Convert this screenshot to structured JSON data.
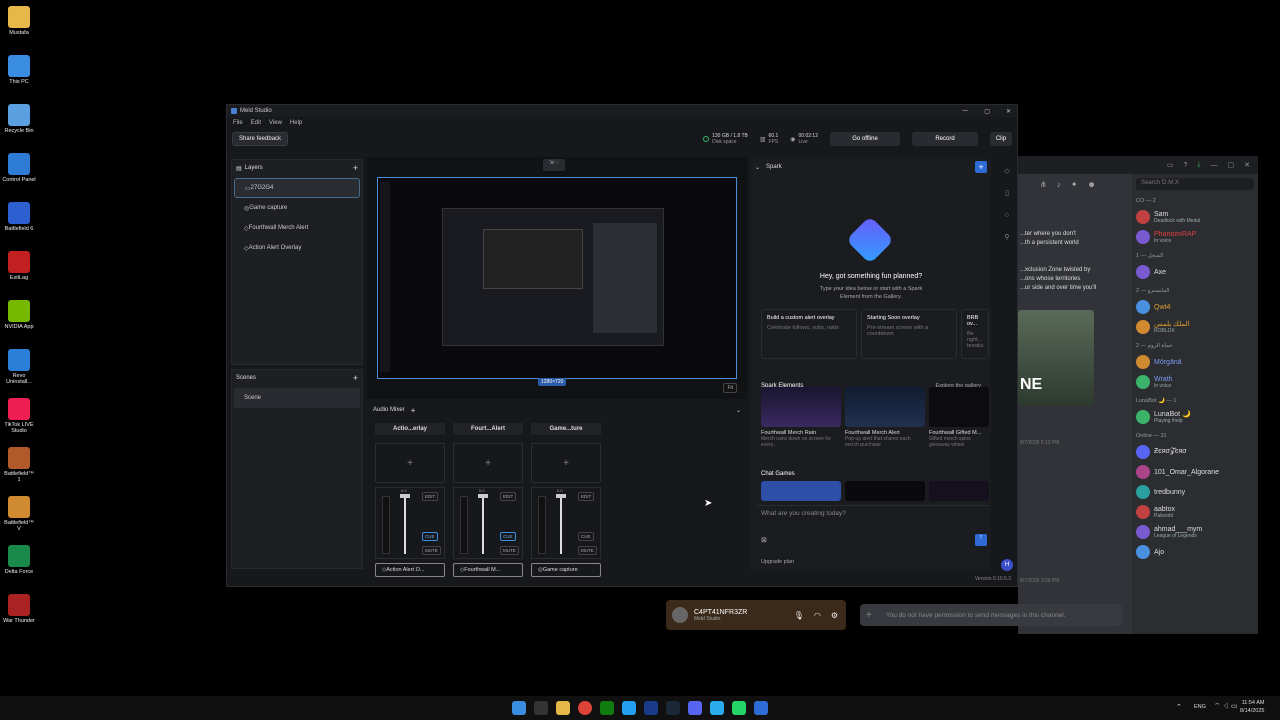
{
  "desktop_icons": [
    {
      "label": "Mustafa",
      "icon": "folder-icon",
      "color": "#e6b84a"
    },
    {
      "label": "This PC",
      "icon": "computer-icon",
      "color": "#3a8de0"
    },
    {
      "label": "Recycle Bin",
      "icon": "recycle-bin-icon",
      "color": "#5aa0e0"
    },
    {
      "label": "Control Panel",
      "icon": "control-panel-icon",
      "color": "#2e7bd6"
    },
    {
      "label": "Battlefield 6",
      "icon": "bf-icon",
      "color": "#2d5fd0"
    },
    {
      "label": "ExitLag",
      "icon": "exitlag-icon",
      "color": "#c02020"
    },
    {
      "label": "NVIDIA App",
      "icon": "nvidia-icon",
      "color": "#76b900"
    },
    {
      "label": "Revo Uninstall...",
      "icon": "revo-icon",
      "color": "#2b7fd8"
    },
    {
      "label": "TikTok LIVE Studio",
      "icon": "tiktok-icon",
      "color": "#ee1d52"
    },
    {
      "label": "Battlefield™ 1",
      "icon": "bf1-icon",
      "color": "#b05a2a"
    },
    {
      "label": "Battlefield™ V",
      "icon": "bfv-icon",
      "color": "#d08a30"
    },
    {
      "label": "Delta Force",
      "icon": "delta-force-icon",
      "color": "#1a8a4a"
    },
    {
      "label": "War Thunder",
      "icon": "war-thunder-icon",
      "color": "#aa2222"
    }
  ],
  "meld": {
    "title": "Meld Studio",
    "menu": [
      "File",
      "Edit",
      "View",
      "Help"
    ],
    "feedback": "Share feedback",
    "stats": {
      "disk": "130 GB / 1.8 TB",
      "disk_label": "Disk space",
      "fps": "60.1",
      "fps_label": "FPS",
      "live_time": "00:02:12",
      "live_label": "Live"
    },
    "buttons": {
      "offline": "Go offline",
      "record": "Record",
      "clip": "Clip"
    },
    "layers_title": "Layers",
    "layers": [
      "27G2G4",
      "Game capture",
      "Fourthwall Merch Alert",
      "Action Alert Overlay"
    ],
    "scenes_title": "Scenes",
    "scenes": [
      "Scene"
    ],
    "resolution": "1280×720",
    "fit_label": "Fit",
    "mixer_title": "Audio Mixer",
    "channels": [
      {
        "header": "Actio...erlay",
        "label": "Action Alert O..."
      },
      {
        "header": "Fourt...Alert",
        "label": "Fourthwall M..."
      },
      {
        "header": "Game...ture",
        "label": "Game capture"
      }
    ],
    "channel_ctrls": {
      "edit": "EDIT",
      "cue": "CUE",
      "mute": "MUTE",
      "db": "0.0"
    },
    "version": "Version 0.10.5.3"
  },
  "spark": {
    "title": "Spark",
    "heading": "Hey, got something fun planned?",
    "subtext": "Type your idea below or start with a Spark Element from the Gallery.",
    "cards": [
      {
        "title": "Build a custom alert overlay",
        "desc": "Celebrate follows, subs, raids"
      },
      {
        "title": "Starting Soon overlay",
        "desc": "Pre-stream screen with a countdown"
      },
      {
        "title": "BRB ov...",
        "desc": "Be right... breaks"
      }
    ],
    "elements_title": "Spark Elements",
    "explore": "Explore the gallery",
    "elements": [
      {
        "title": "Fourthwall Merch Rain",
        "desc": "Merch rains down on screen for every..."
      },
      {
        "title": "Fourthwall Merch Alert",
        "desc": "Pop-up alert that shares each merch purchase"
      },
      {
        "title": "Fourthwall Gifted M...",
        "desc": "Gifted merch spins giveaway wheel"
      }
    ],
    "chat_games": "Chat Games",
    "prompt_placeholder": "What are you creating today?",
    "upgrade": "Upgrade plan"
  },
  "discord": {
    "search": "Search Ɗ.M.X",
    "channel_text": [
      "...ter where you don't",
      "...th a persistent world",
      "...xclusion Zone twisted by",
      "...ons whose territories",
      "...ur side and over time you'll"
    ],
    "groups": [
      {
        "name": "CO — 2",
        "members": [
          {
            "name": "Sam",
            "sub": "Deadlock with Medal"
          },
          {
            "name": "PhantomRAP",
            "sub": "In voice"
          }
        ]
      },
      {
        "name": "المبجل — 1",
        "members": [
          {
            "name": "Axe",
            "sub": ""
          }
        ]
      },
      {
        "name": "المايسترو — 2",
        "members": [
          {
            "name": "Qwt4",
            "sub": ""
          },
          {
            "name": "الملك يلمس",
            "sub": "ROBLOX"
          }
        ]
      },
      {
        "name": "حماة الروم — 2",
        "members": [
          {
            "name": "Mōrgānā",
            "sub": ""
          },
          {
            "name": "Wrath",
            "sub": "In voice"
          }
        ]
      },
      {
        "name": "LunaBot 🌙 — 1",
        "members": [
          {
            "name": "LunaBot 🌙",
            "sub": "Playing /help"
          }
        ]
      },
      {
        "name": "Online — 31",
        "members": [
          {
            "name": "Ƶєяσ𝓩єяσ",
            "sub": ""
          },
          {
            "name": "101_Omar_Algorane",
            "sub": ""
          },
          {
            "name": "tredbunny",
            "sub": ""
          },
          {
            "name": "aabtox",
            "sub": "Palworld"
          },
          {
            "name": "ahmad___mym",
            "sub": "League of Legends"
          },
          {
            "name": "Ajo",
            "sub": ""
          }
        ]
      }
    ],
    "user": {
      "name": "C4PT41NFR3ZR",
      "status": "Meld Studio"
    },
    "message_placeholder": "You do not have permission to send messages in this channel.",
    "timestamps": [
      "8/7/2025 5:12 PM",
      "8/7/2025 3:06 PM"
    ]
  },
  "taskbar": {
    "lang": "ENG",
    "time": "11:54 AM",
    "date": "8/14/2025"
  }
}
